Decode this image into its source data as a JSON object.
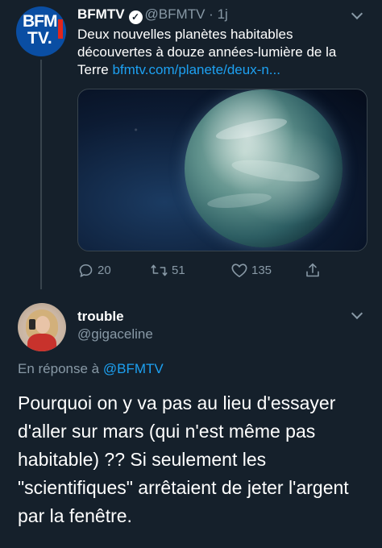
{
  "tweet1": {
    "avatar": {
      "line1": "BFM",
      "line2": "TV."
    },
    "name": "BFMTV",
    "handle": "@BFMTV",
    "separator": "·",
    "time": "1j",
    "text": "Deux nouvelles planètes habitables découvertes à douze années-lumière de la Terre",
    "link": "bfmtv.com/planete/deux-n...",
    "actions": {
      "reply_count": "20",
      "retweet_count": "51",
      "like_count": "135"
    }
  },
  "reply": {
    "name": "trouble",
    "handle": "@gigaceline",
    "context_prefix": "En réponse à",
    "context_mention": "@BFMTV",
    "text": "Pourquoi on y va pas au lieu d'essayer d'aller sur mars (qui n'est même pas habitable) ?? Si seulement les \"scientifiques\" arrêtaient de jeter l'argent par la fenêtre."
  },
  "colors": {
    "background": "#15202b",
    "secondary_text": "#8899a6",
    "link": "#1da1f2",
    "brand_blue": "#0a4ea3",
    "brand_red": "#e1261c"
  },
  "icons": [
    "verified-badge-icon",
    "chevron-down-icon",
    "reply-icon",
    "retweet-icon",
    "like-icon",
    "share-icon"
  ]
}
